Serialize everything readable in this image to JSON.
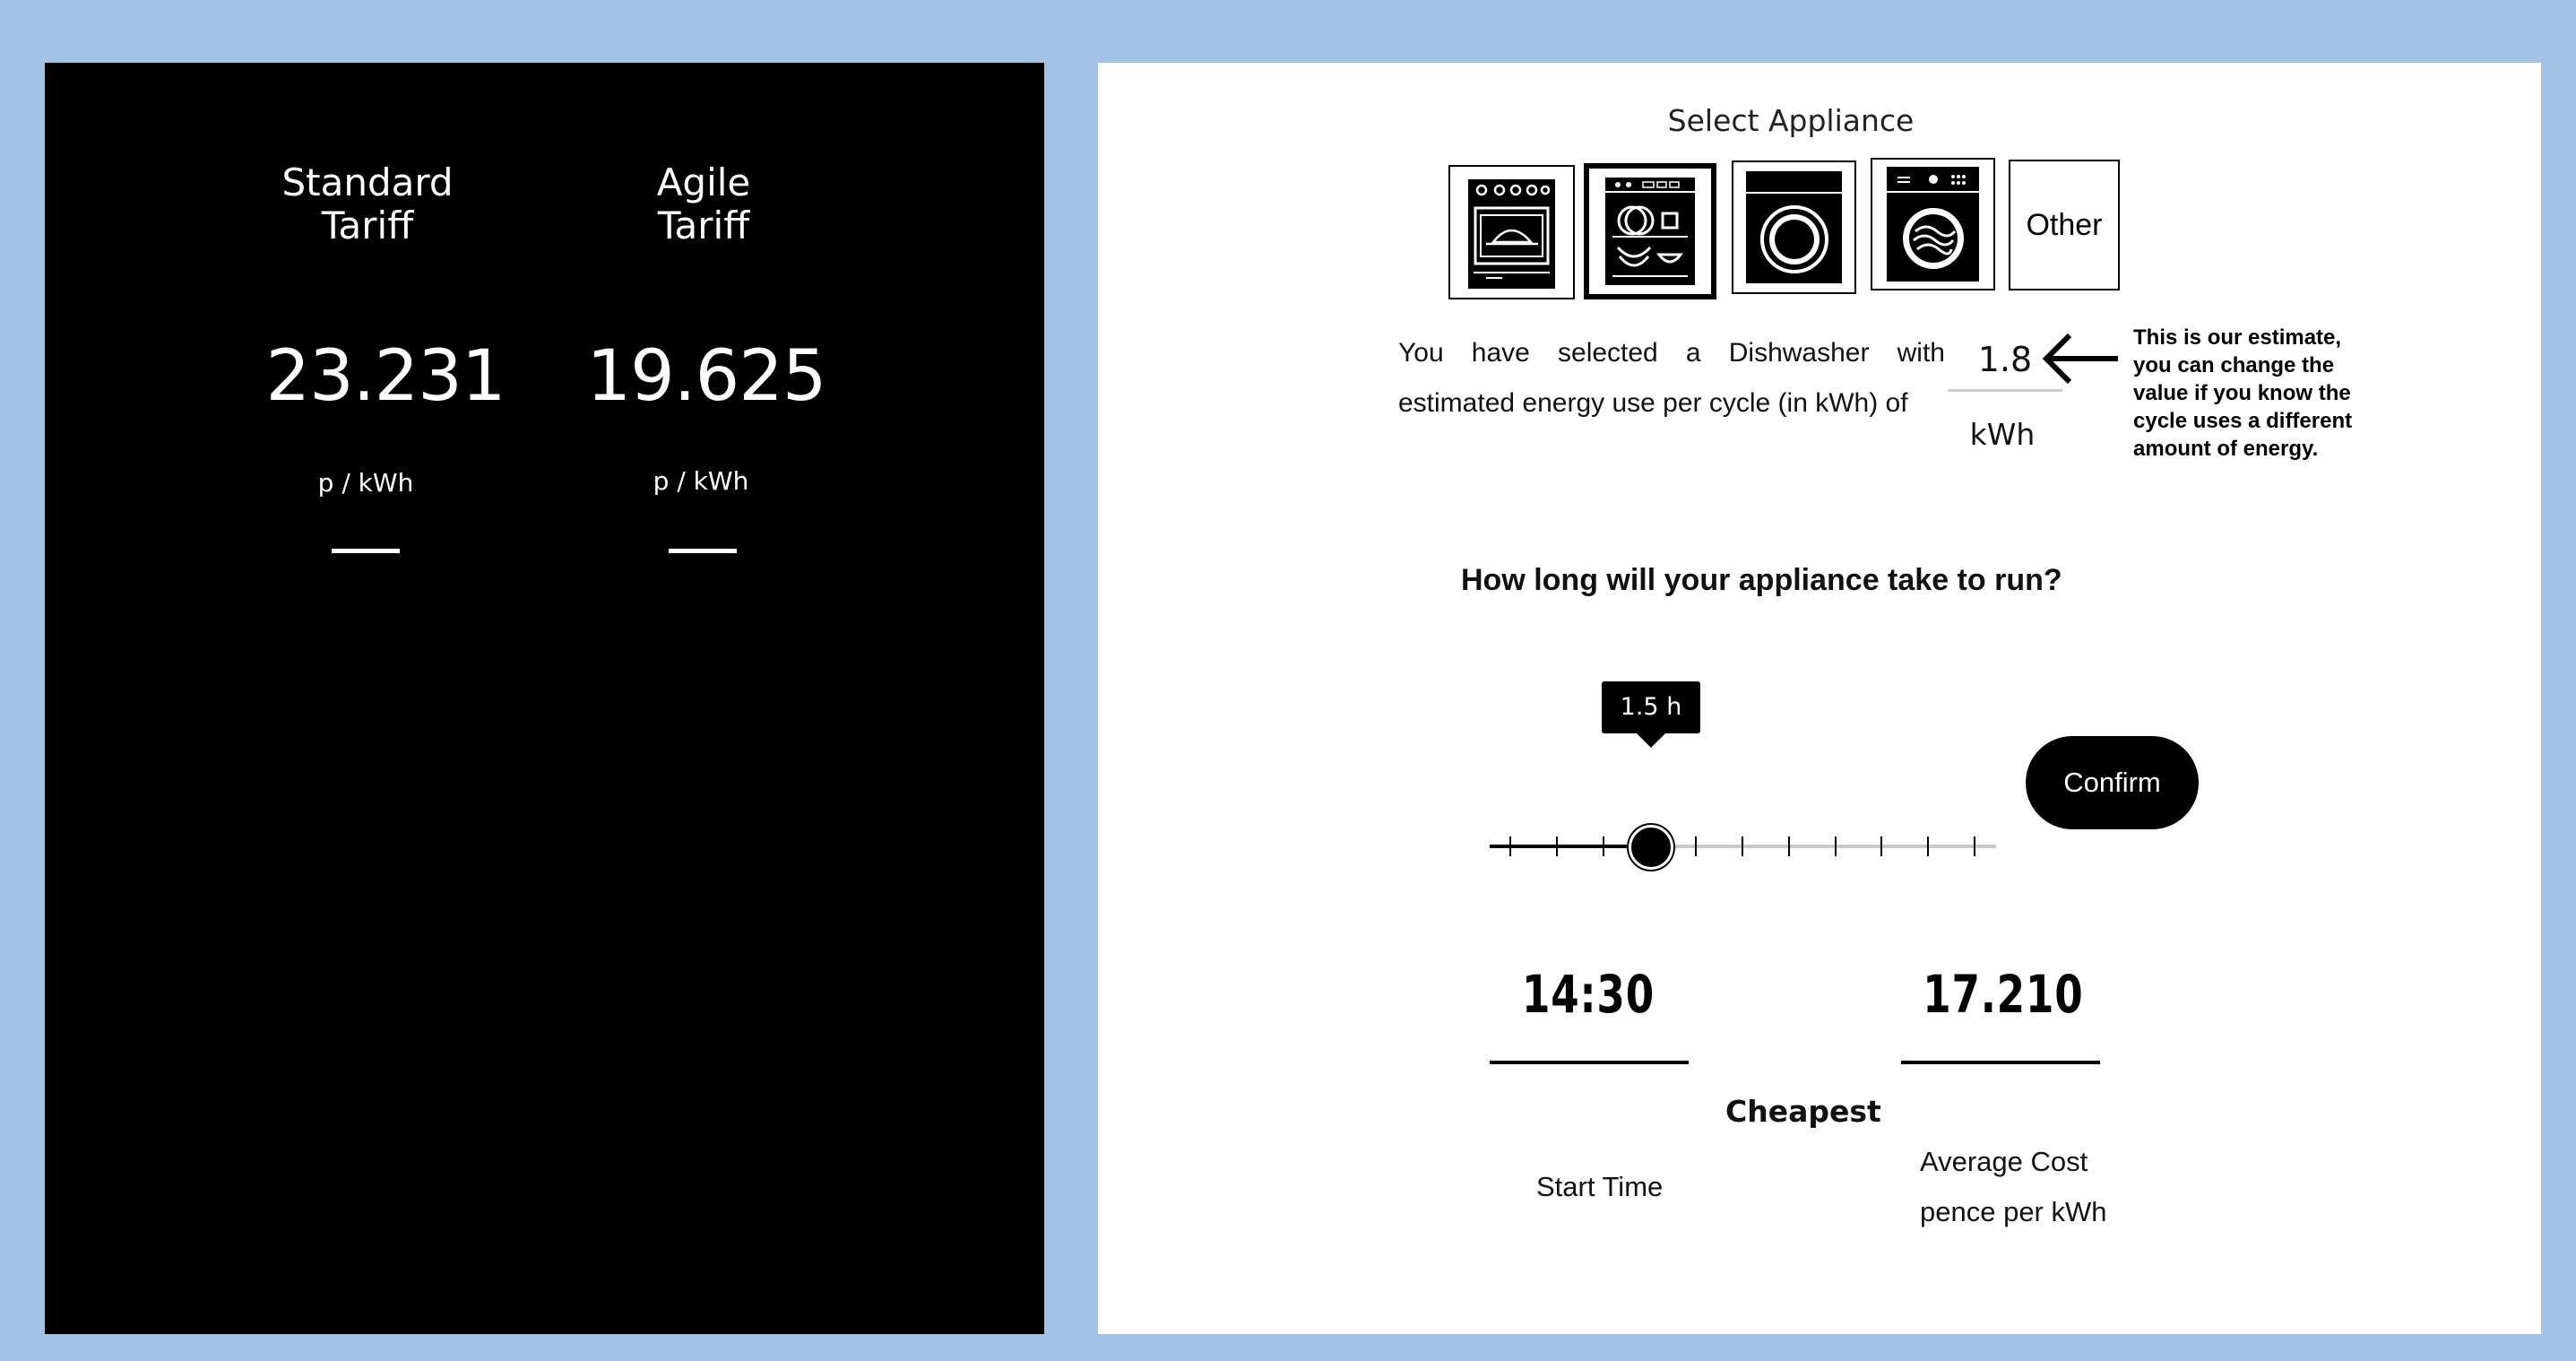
{
  "tariffs": {
    "standard": {
      "name_line1": "Standard",
      "name_line2": "Tariff",
      "value": "23.231",
      "unit": "p / kWh"
    },
    "agile": {
      "name_line1": "Agile",
      "name_line2": "Tariff",
      "value": "19.625",
      "unit": "p / kWh"
    }
  },
  "appliance_selector": {
    "title": "Select Appliance",
    "items": [
      {
        "icon": "oven-icon",
        "selected": false
      },
      {
        "icon": "dishwasher-icon",
        "selected": true
      },
      {
        "icon": "washing-machine-icon",
        "selected": false
      },
      {
        "icon": "tumble-dryer-icon",
        "selected": false
      },
      {
        "label": "Other",
        "selected": false
      }
    ]
  },
  "estimate": {
    "text_line1": "You have selected a Dishwasher with",
    "text_line2": "estimated energy use per cycle (in kWh) of",
    "value": "1.8",
    "unit": "kWh",
    "hint": "This is our estimate, you can change the value if you know the cycle uses a different amount of energy."
  },
  "duration": {
    "question": "How long will your appliance take to run?",
    "tooltip": "1.5 h",
    "slider_value_fraction": 0.3
  },
  "confirm_label": "Confirm",
  "result": {
    "start_time": "14:30",
    "start_time_label": "Start Time",
    "cheapest_label": "Cheapest",
    "average_cost": "17.210",
    "average_cost_label_line1": "Average Cost",
    "average_cost_label_line2": "pence per kWh"
  }
}
